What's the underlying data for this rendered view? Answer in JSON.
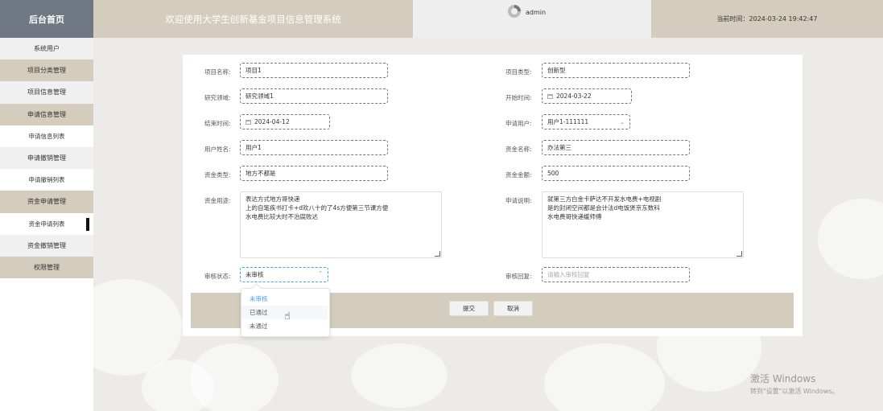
{
  "header": {
    "brand": "后台首页",
    "title": "欢迎使用大学生创新基金项目信息管理系统",
    "username": "admin",
    "time": "当前时间：2024-03-24 19:42:47"
  },
  "sidebar": {
    "items": [
      {
        "label": "系统用户"
      },
      {
        "label": "项目分类管理"
      },
      {
        "label": "项目信息管理"
      },
      {
        "label": "申请信息管理"
      },
      {
        "label": "申请信息列表"
      },
      {
        "label": "申请撤销管理"
      },
      {
        "label": "申请撤销列表"
      },
      {
        "label": "资金申请管理"
      },
      {
        "label": "资金申请列表"
      },
      {
        "label": "资金撤销管理"
      },
      {
        "label": "权限管理"
      }
    ]
  },
  "form": {
    "project_name": {
      "label": "项目名称:",
      "value": "项目1"
    },
    "project_type": {
      "label": "项目类型:",
      "value": "创新型"
    },
    "research_field": {
      "label": "研究领域:",
      "value": "研究领域1"
    },
    "start_time": {
      "label": "开始时间:",
      "value": "2024-03-22"
    },
    "end_time": {
      "label": "结束时间:",
      "value": "2024-04-12"
    },
    "applicant": {
      "label": "申请用户:",
      "value": "用户1-111111"
    },
    "user_name": {
      "label": "用户姓名:",
      "value": "用户1"
    },
    "fund_name": {
      "label": "资金名称:",
      "value": "办法第三"
    },
    "fund_type": {
      "label": "资金类型:",
      "value": "地方不都是"
    },
    "fund_amount": {
      "label": "资金金额:",
      "value": "500"
    },
    "fund_usage": {
      "label": "资金用途:",
      "lines": [
        "表达方式地方哥快递",
        "上的自笔疾书打卡+d欢八十的了4s方便第三节课方便",
        "水电费比较大时不治腐败达"
      ]
    },
    "apply_desc": {
      "label": "申请说明:",
      "lines": [
        "就第三方白金卡萨达不开发水电费+电视剧",
        "是的封闭空间都是会计法d电饭煲京东数科",
        "水电费哥快递缓师傅"
      ]
    },
    "review_status": {
      "label": "审核状态:",
      "value": "未审核"
    },
    "review_reply": {
      "label": "审核回复:",
      "placeholder": "请输入审核回复"
    }
  },
  "buttons": {
    "submit": "提交",
    "cancel": "取消"
  },
  "dropdown": {
    "options": [
      "未审核",
      "已通过",
      "未通过"
    ],
    "selected": "未审核",
    "hovered": "已通过"
  },
  "watermark": {
    "line1": "激活 Windows",
    "line2": "转到\"设置\"以激活 Windows。"
  },
  "colors": {
    "accent": "#d4cdbd",
    "brand_bg": "#6f7883",
    "link_blue": "#409eff"
  }
}
